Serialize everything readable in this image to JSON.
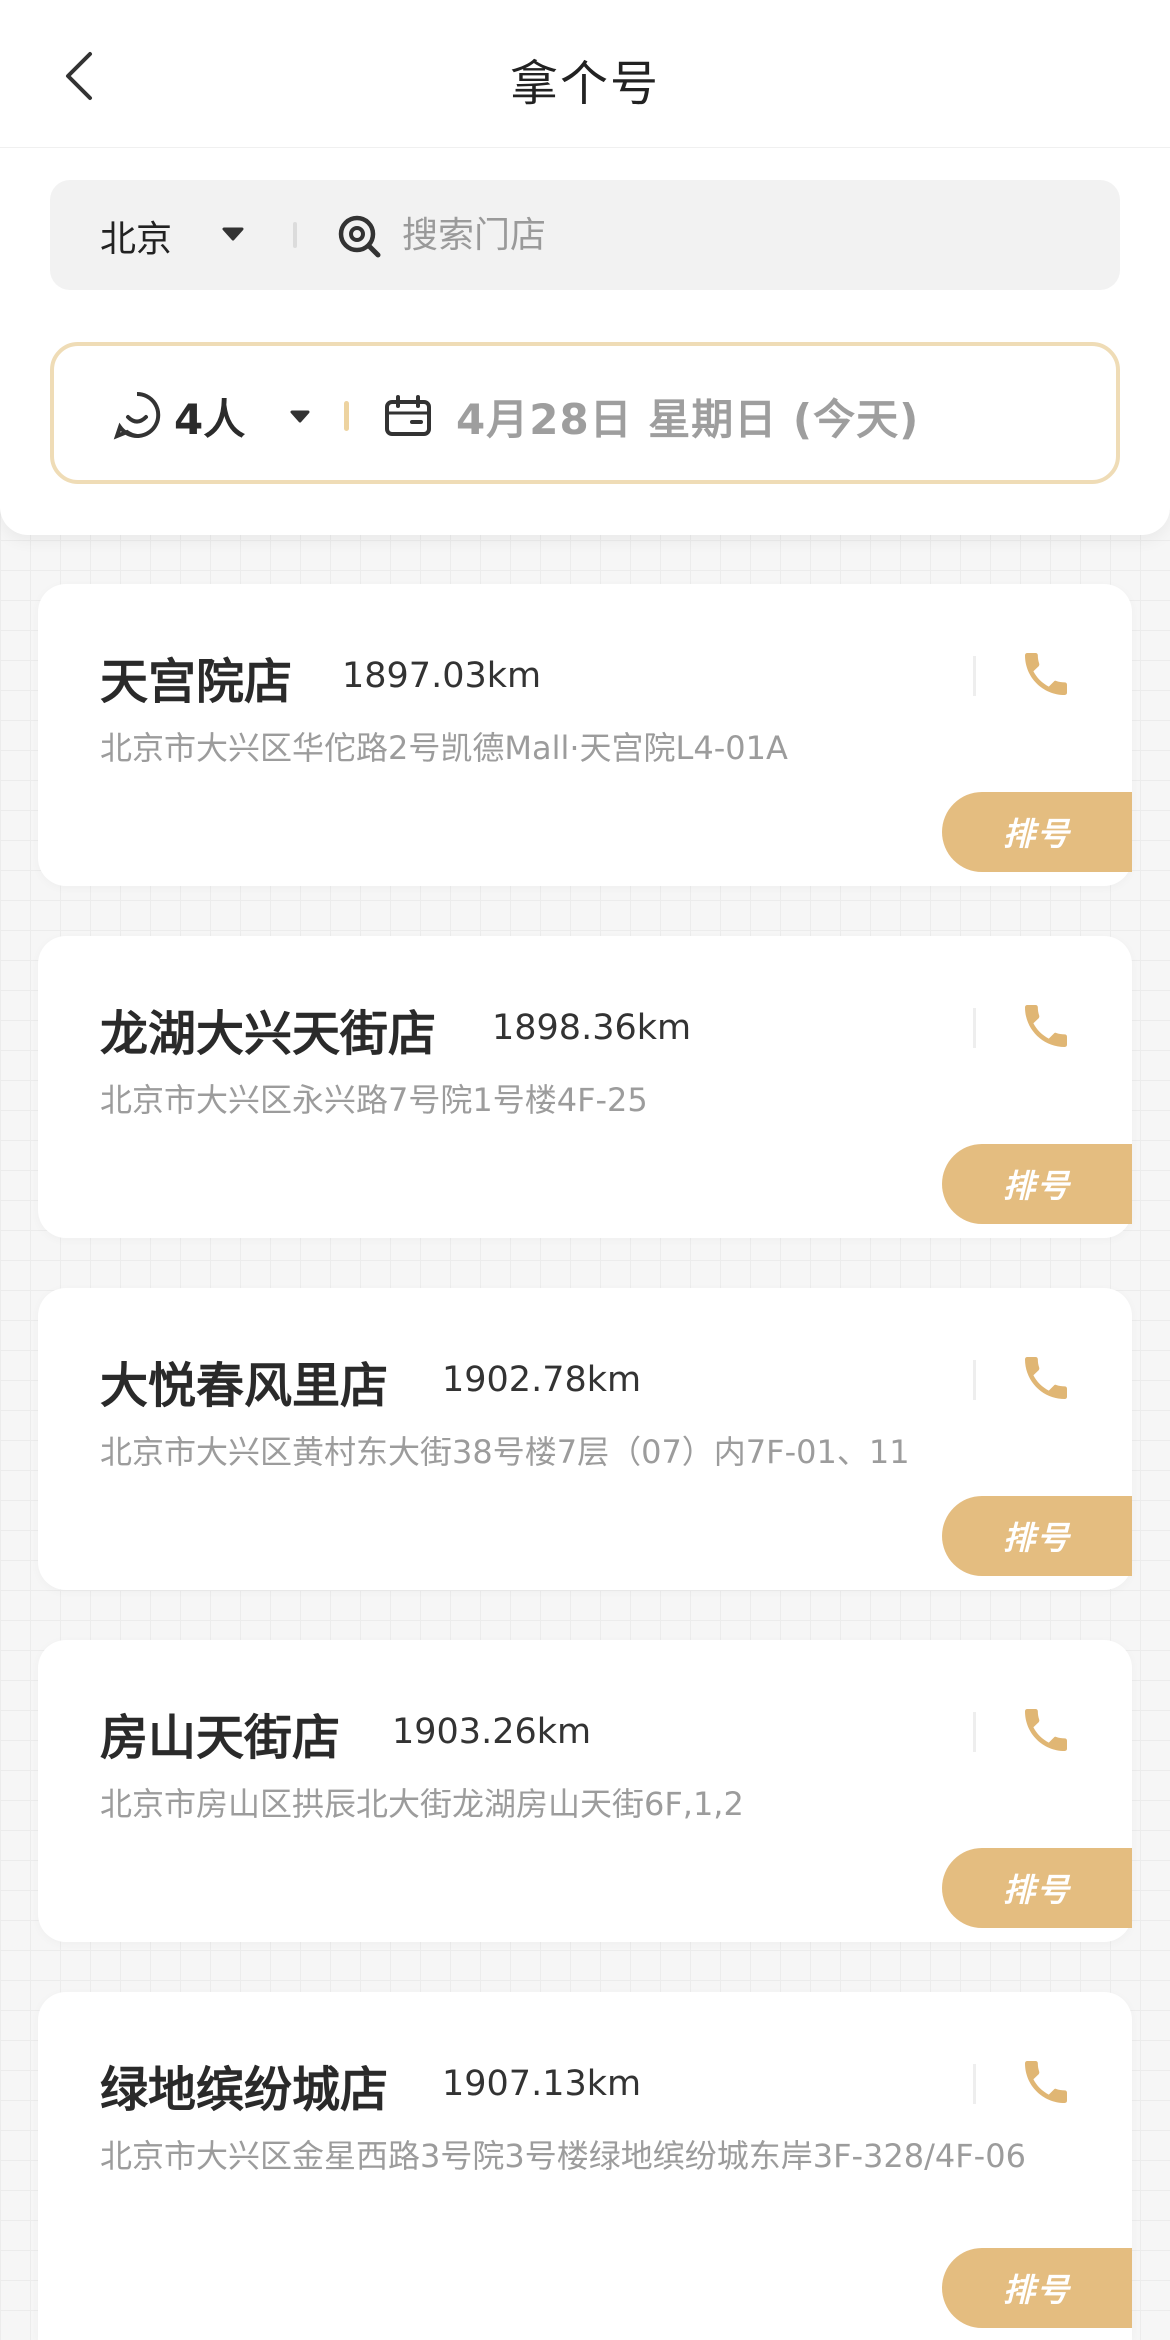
{
  "header": {
    "title": "拿个号"
  },
  "search": {
    "city": "北京",
    "placeholder": "搜索门店"
  },
  "filter": {
    "people": "4人",
    "date": "4月28日 星期日 (今天)"
  },
  "colors": {
    "accent": "#e4bd80",
    "accent_border": "#efdcb6"
  },
  "stores": [
    {
      "name": "天宫院店",
      "distance": "1897.03km",
      "address": "北京市大兴区华佗路2号凯德Mall·天宫院L4-01A",
      "queue_label": "排号"
    },
    {
      "name": "龙湖大兴天街店",
      "distance": "1898.36km",
      "address": "北京市大兴区永兴路7号院1号楼4F-25",
      "queue_label": "排号"
    },
    {
      "name": "大悦春风里店",
      "distance": "1902.78km",
      "address": "北京市大兴区黄村东大街38号楼7层（07）内7F-01、11",
      "queue_label": "排号"
    },
    {
      "name": "房山天街店",
      "distance": "1903.26km",
      "address": "北京市房山区拱辰北大街龙湖房山天街6F,1,2",
      "queue_label": "排号"
    },
    {
      "name": "绿地缤纷城店",
      "distance": "1907.13km",
      "address": "北京市大兴区金星西路3号院3号楼绿地缤纷城东岸3F-328/4F-06",
      "queue_label": "排号"
    }
  ]
}
